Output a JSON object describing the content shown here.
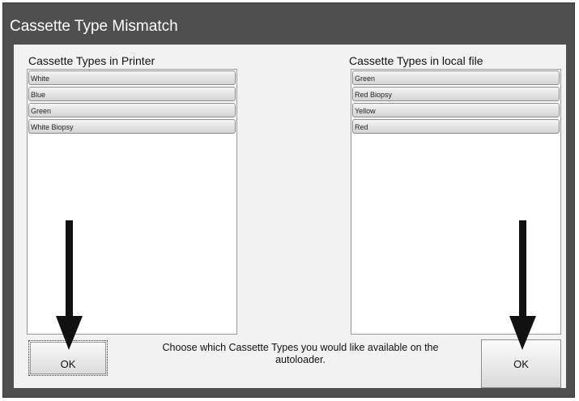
{
  "dialog": {
    "title": "Cassette Type Mismatch",
    "message": "Choose which Cassette Types you would like available on the autoloader."
  },
  "printer_list": {
    "label": "Cassette Types in Printer",
    "items": [
      "White",
      "Blue",
      "Green",
      "White Biopsy"
    ]
  },
  "local_list": {
    "label": "Cassette Types in local file",
    "items": [
      "Green",
      "Red Biopsy",
      "Yellow",
      "Red"
    ]
  },
  "buttons": {
    "left_ok": "OK",
    "right_ok": "OK"
  },
  "colors": {
    "window_bg": "#4f4f4f",
    "panel_bg": "#f2f2f2",
    "arrow": "#111111"
  },
  "icons": {
    "annotation_arrow": "down-arrow-icon"
  }
}
